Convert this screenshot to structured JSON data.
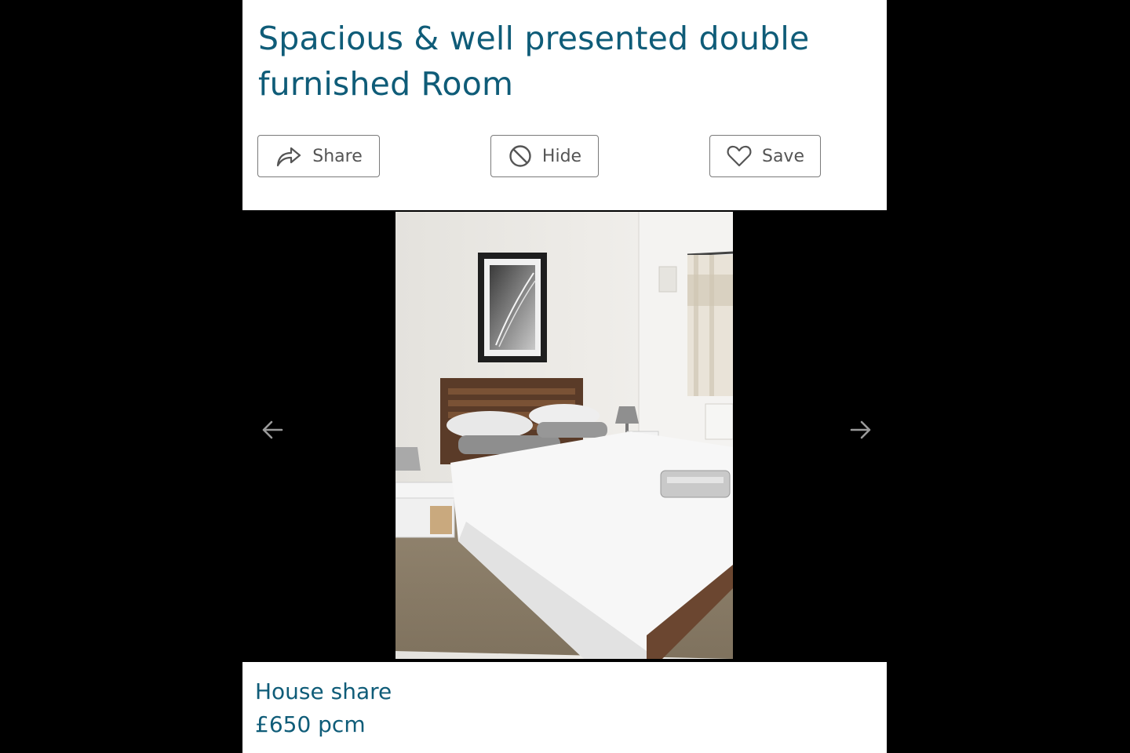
{
  "listing": {
    "title": "Spacious & well presented double furnished Room",
    "property_type": "House share",
    "price": "£650 pcm"
  },
  "actions": {
    "share_label": "Share",
    "hide_label": "Hide",
    "save_label": "Save"
  },
  "gallery": {
    "prev_icon": "arrow-left-icon",
    "next_icon": "arrow-right-icon",
    "photo_subject": "bedroom"
  },
  "colors": {
    "title": "#0f5c78",
    "button_border": "#7a7a7a",
    "button_text": "#555555",
    "backdrop": "#000000"
  }
}
